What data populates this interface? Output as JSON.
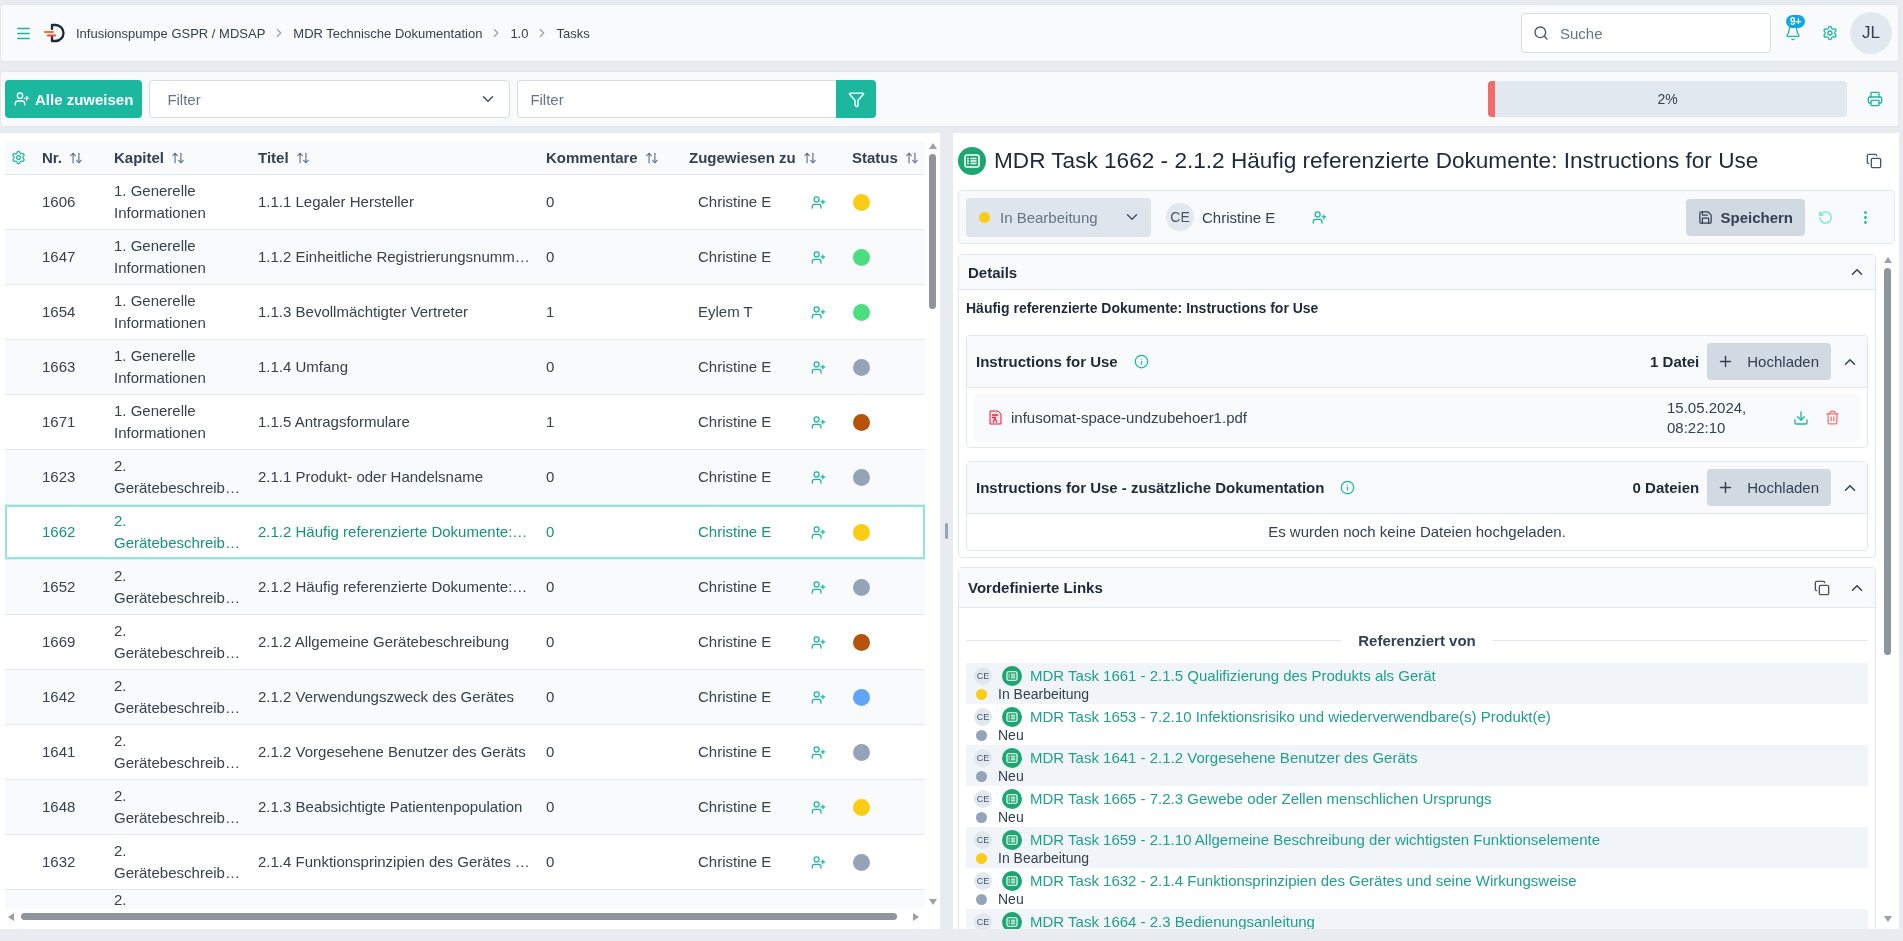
{
  "header": {
    "breadcrumb": [
      "Infusionspumpe GSPR / MDSAP",
      "MDR Technische Dokumentation",
      "1.0",
      "Tasks"
    ],
    "search": {
      "placeholder": "Suche"
    },
    "notification_count": "9+",
    "user_initials": "JL"
  },
  "toolbar": {
    "assign_all_button": "Alle zuweisen",
    "filter_select": {
      "placeholder": "Filter"
    },
    "filter_input": {
      "placeholder": "Filter"
    },
    "progress": {
      "level": 0.02,
      "reading": "2%"
    }
  },
  "table": {
    "columns": [
      "Nr.",
      "Kapitel",
      "Titel",
      "Kommentare",
      "Zugewiesen zu",
      "Status"
    ],
    "rows": [
      {
        "nr": "1606",
        "kapitel": "1. Generelle Informationen",
        "titel": "1.1.1 Legaler Hersteller",
        "kommentare": "0",
        "zugewiesen": "Christine E",
        "color": "#facc15",
        "selected": false
      },
      {
        "nr": "1647",
        "kapitel": "1. Generelle Informationen",
        "titel": "1.1.2 Einheitliche Registrierungsnumm…",
        "kommentare": "0",
        "zugewiesen": "Christine E",
        "color": "#4ade80",
        "selected": false
      },
      {
        "nr": "1654",
        "kapitel": "1. Generelle Informationen",
        "titel": "1.1.3 Bevollmächtigter Vertreter",
        "kommentare": "1",
        "zugewiesen": "Eylem T",
        "color": "#4ade80",
        "selected": false
      },
      {
        "nr": "1663",
        "kapitel": "1. Generelle Informationen",
        "titel": "1.1.4 Umfang",
        "kommentare": "0",
        "zugewiesen": "Christine E",
        "color": "#94a3b8",
        "selected": false
      },
      {
        "nr": "1671",
        "kapitel": "1. Generelle Informationen",
        "titel": "1.1.5 Antragsformulare",
        "kommentare": "1",
        "zugewiesen": "Christine E",
        "color": "#b45309",
        "selected": false
      },
      {
        "nr": "1623",
        "kapitel": "2. Gerätebeschreib…",
        "titel": "2.1.1 Produkt- oder Handelsname",
        "kommentare": "0",
        "zugewiesen": "Christine E",
        "color": "#94a3b8",
        "selected": false
      },
      {
        "nr": "1662",
        "kapitel": "2. Gerätebeschreib…",
        "titel": "2.1.2 Häufig referenzierte Dokumente:…",
        "kommentare": "0",
        "zugewiesen": "Christine E",
        "color": "#facc15",
        "selected": true
      },
      {
        "nr": "1652",
        "kapitel": "2. Gerätebeschreib…",
        "titel": "2.1.2 Häufig referenzierte Dokumente:…",
        "kommentare": "0",
        "zugewiesen": "Christine E",
        "color": "#94a3b8",
        "selected": false
      },
      {
        "nr": "1669",
        "kapitel": "2. Gerätebeschreib…",
        "titel": "2.1.2 Allgemeine Gerätebeschreibung",
        "kommentare": "0",
        "zugewiesen": "Christine E",
        "color": "#b45309",
        "selected": false
      },
      {
        "nr": "1642",
        "kapitel": "2. Gerätebeschreib…",
        "titel": "2.1.2 Verwendungszweck des Gerätes",
        "kommentare": "0",
        "zugewiesen": "Christine E",
        "color": "#60a5fa",
        "selected": false
      },
      {
        "nr": "1641",
        "kapitel": "2. Gerätebeschreib…",
        "titel": "2.1.2 Vorgesehene Benutzer des Geräts",
        "kommentare": "0",
        "zugewiesen": "Christine E",
        "color": "#94a3b8",
        "selected": false
      },
      {
        "nr": "1648",
        "kapitel": "2. Gerätebeschreib…",
        "titel": "2.1.3 Beabsichtigte Patientenpopulation",
        "kommentare": "0",
        "zugewiesen": "Christine E",
        "color": "#facc15",
        "selected": false
      },
      {
        "nr": "1632",
        "kapitel": "2. Gerätebeschreib…",
        "titel": "2.1.4 Funktionsprinzipien des Gerätes …",
        "kommentare": "0",
        "zugewiesen": "Christine E",
        "color": "#94a3b8",
        "selected": false
      },
      {
        "kapitel": "2.",
        "selected": false
      }
    ]
  },
  "task": {
    "title": "MDR Task 1662 - 2.1.2 Häufig referenzierte Dokumente: Instructions for Use",
    "status": {
      "label": "In Bearbeitung",
      "color": "#facc15"
    },
    "assignee": {
      "initials": "CE",
      "name": "Christine E"
    },
    "save_button": "Speichern",
    "details": {
      "title": "Details",
      "expanded": true,
      "heading": "Häufig referenzierte Dokumente: Instructions for Use",
      "file_groups": [
        {
          "title": "Instructions for Use",
          "count": "1 Datei",
          "upload_button": "Hochladen",
          "expanded": true,
          "files": [
            {
              "name": "infusomat-space-undzubehoer1.pdf",
              "date": "15.05.2024, 08:22:10"
            }
          ]
        },
        {
          "title": "Instructions for Use - zusätzliche Dokumentation",
          "count": "0 Dateien",
          "upload_button": "Hochladen",
          "expanded": true,
          "empty_text": "Es wurden noch keine Dateien hochgeladen."
        }
      ]
    },
    "links": {
      "title": "Vordefinierte Links",
      "expanded": true,
      "divider_label": "Referenziert von",
      "items": [
        {
          "initials": "CE",
          "title": "MDR Task 1661 - 2.1.5 Qualifizierung des Produkts als Gerät",
          "status": "In Bearbeitung",
          "color": "#facc15"
        },
        {
          "initials": "CE",
          "title": "MDR Task 1653 - 7.2.10 Infektionsrisiko und wiederverwendbare(s) Produkt(e)",
          "status": "Neu",
          "color": "#94a3b8"
        },
        {
          "initials": "CE",
          "title": "MDR Task 1641 - 2.1.2 Vorgesehene Benutzer des Geräts",
          "status": "Neu",
          "color": "#94a3b8"
        },
        {
          "initials": "CE",
          "title": "MDR Task 1665 - 7.2.3 Gewebe oder Zellen menschlichen Ursprungs",
          "status": "Neu",
          "color": "#94a3b8"
        },
        {
          "initials": "CE",
          "title": "MDR Task 1659 - 2.1.10 Allgemeine Beschreibung der wichtigsten Funktionselemente",
          "status": "In Bearbeitung",
          "color": "#facc15"
        },
        {
          "initials": "CE",
          "title": "MDR Task 1632 - 2.1.4 Funktionsprinzipien des Gerätes und seine Wirkungsweise",
          "status": "Neu",
          "color": "#94a3b8"
        },
        {
          "initials": "CE",
          "title": "MDR Task 1664 - 2.3 Bedienungsanleitung"
        }
      ]
    }
  }
}
